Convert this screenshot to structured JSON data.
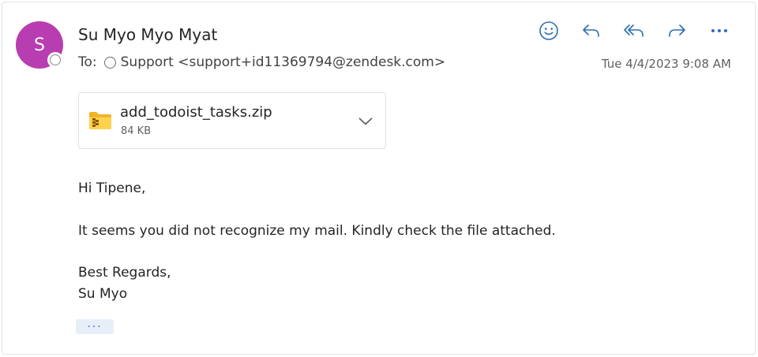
{
  "message": {
    "sender_initial": "S",
    "sender_name": "Su Myo Myo Myat",
    "to_label": "To:",
    "recipient": "Support <support+id11369794@zendesk.com>",
    "timestamp": "Tue 4/4/2023 9:08 AM"
  },
  "actions": [
    {
      "name": "emoji-reaction",
      "icon": "smile-icon"
    },
    {
      "name": "reply",
      "icon": "reply-icon"
    },
    {
      "name": "reply-all",
      "icon": "reply-all-icon"
    },
    {
      "name": "forward",
      "icon": "forward-icon"
    },
    {
      "name": "more-actions",
      "icon": "more-horizontal-icon"
    }
  ],
  "attachment": {
    "file_name": "add_todoist_tasks.zip",
    "file_size": "84 KB",
    "icon": "zip-folder-icon"
  },
  "body": {
    "greeting": "Hi Tipene,",
    "paragraph": "It seems you did not recognize my mail. Kindly check the file attached.",
    "closing": "Best Regards,",
    "signature": "Su Myo",
    "show_more": "···"
  },
  "colors": {
    "accent": "#2b6cb0",
    "avatar": "#b83db0",
    "show_more_bg": "#e7eef7"
  }
}
